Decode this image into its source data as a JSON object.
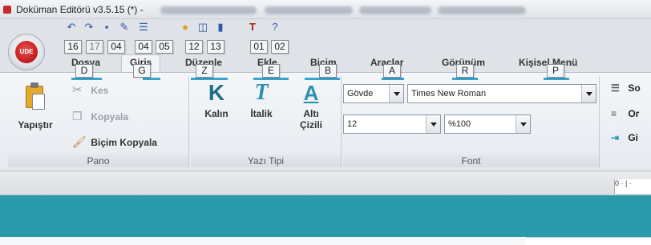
{
  "window": {
    "title": "Doküman Editörü v3.5.15 (*) -"
  },
  "app_button": {
    "label": "UDE"
  },
  "quick_access": {
    "icons": [
      "undo-icon",
      "redo-icon",
      "save-icon",
      "edit-icon",
      "list-icon",
      "lightbulb-icon",
      "shape-icon",
      "comment-icon",
      "text-format-icon",
      "help-icon"
    ],
    "keytips": [
      "16",
      "17",
      "04",
      "04",
      "05",
      "12",
      "13",
      "01",
      "02"
    ]
  },
  "tabs": [
    {
      "label": "Dosya",
      "keytip": "D"
    },
    {
      "label": "Giriş",
      "keytip": "G",
      "active": true
    },
    {
      "label": "Düzenle",
      "keytip": "Z"
    },
    {
      "label": "Ekle",
      "keytip": "E"
    },
    {
      "label": "Biçim",
      "keytip": "B"
    },
    {
      "label": "Araçlar",
      "keytip": "A"
    },
    {
      "label": "Görünüm",
      "keytip": "R"
    },
    {
      "label": "Kişisel Menü",
      "keytip": "P"
    }
  ],
  "clipboard": {
    "group_label": "Pano",
    "paste": "Yapıştır",
    "cut": "Kes",
    "copy": "Kopyala",
    "format_painter": "Biçim Kopyala"
  },
  "font_style": {
    "group_label": "Yazı Tipi",
    "bold": "Kalın",
    "italic": "İtalik",
    "underline_line1": "Altı",
    "underline_line2": "Çizili",
    "bold_glyph": "K",
    "italic_glyph": "T",
    "underline_glyph": "A"
  },
  "font": {
    "group_label": "Font",
    "style_value": "Gövde",
    "family_value": "Times New Roman",
    "size_value": "12",
    "scale_value": "%100"
  },
  "paragraph_partial": {
    "items": [
      "So",
      "Or",
      "Gi"
    ]
  },
  "ruler": {
    "text": "0 · | ·"
  },
  "colors": {
    "accent": "#37a3cf",
    "teal": "#2a9aaa",
    "app_red": "#c11a1a"
  }
}
